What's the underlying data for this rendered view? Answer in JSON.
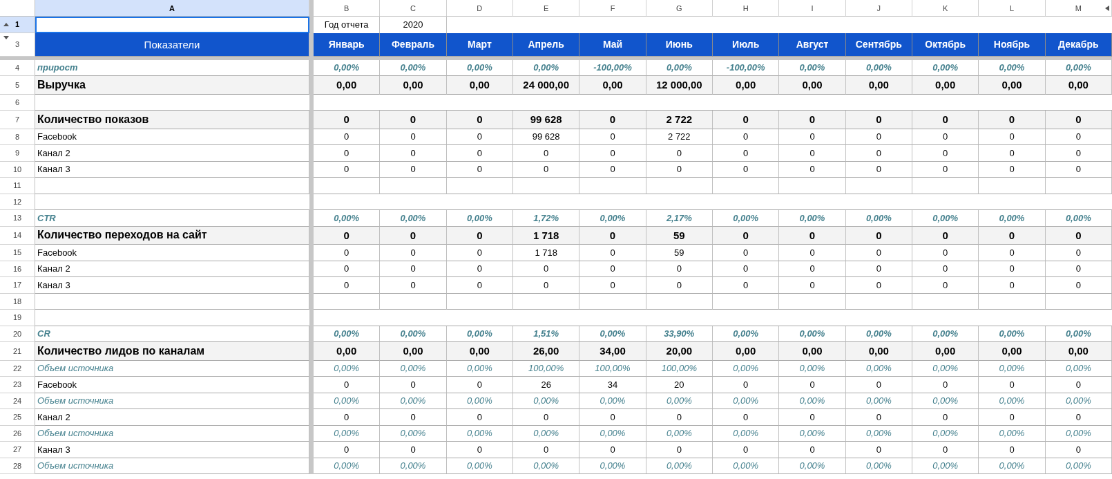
{
  "columns": [
    {
      "letter": "A",
      "selected": true
    },
    {
      "letter": "B",
      "selected": false
    },
    {
      "letter": "C",
      "selected": false
    },
    {
      "letter": "D",
      "selected": false
    },
    {
      "letter": "E",
      "selected": false
    },
    {
      "letter": "F",
      "selected": false
    },
    {
      "letter": "G",
      "selected": false
    },
    {
      "letter": "H",
      "selected": false
    },
    {
      "letter": "I",
      "selected": false
    },
    {
      "letter": "J",
      "selected": false
    },
    {
      "letter": "K",
      "selected": false
    },
    {
      "letter": "L",
      "selected": false
    },
    {
      "letter": "M",
      "selected": false
    }
  ],
  "top_row": {
    "number": "1",
    "selected": true,
    "label_cell_selected": true,
    "year_label": "Год отчета",
    "year": "2020"
  },
  "header_row": {
    "number": "3",
    "title": "Показатели",
    "months": [
      "Январь",
      "Февраль",
      "Март",
      "Апрель",
      "Май",
      "Июнь",
      "Июль",
      "Август",
      "Сентябрь",
      "Октябрь",
      "Ноябрь",
      "Декабрь"
    ]
  },
  "rows": [
    {
      "number": "4",
      "kind": "pct",
      "label": "прирост",
      "values": [
        "0,00%",
        "0,00%",
        "0,00%",
        "0,00%",
        "-100,00%",
        "0,00%",
        "-100,00%",
        "0,00%",
        "0,00%",
        "0,00%",
        "0,00%",
        "0,00%"
      ]
    },
    {
      "number": "5",
      "kind": "total",
      "label": "Выручка",
      "values": [
        "0,00",
        "0,00",
        "0,00",
        "24 000,00",
        "0,00",
        "12 000,00",
        "0,00",
        "0,00",
        "0,00",
        "0,00",
        "0,00",
        "0,00"
      ]
    },
    {
      "number": "6",
      "kind": "gap"
    },
    {
      "number": "7",
      "kind": "total",
      "label": "Количество показов",
      "values": [
        "0",
        "0",
        "0",
        "99 628",
        "0",
        "2 722",
        "0",
        "0",
        "0",
        "0",
        "0",
        "0"
      ]
    },
    {
      "number": "8",
      "kind": "plain",
      "label": "Facebook",
      "values": [
        "0",
        "0",
        "0",
        "99 628",
        "0",
        "2 722",
        "0",
        "0",
        "0",
        "0",
        "0",
        "0"
      ]
    },
    {
      "number": "9",
      "kind": "plain",
      "label": "Канал 2",
      "values": [
        "0",
        "0",
        "0",
        "0",
        "0",
        "0",
        "0",
        "0",
        "0",
        "0",
        "0",
        "0"
      ]
    },
    {
      "number": "10",
      "kind": "plain",
      "label": "Канал 3",
      "values": [
        "0",
        "0",
        "0",
        "0",
        "0",
        "0",
        "0",
        "0",
        "0",
        "0",
        "0",
        "0"
      ]
    },
    {
      "number": "11",
      "kind": "blank"
    },
    {
      "number": "12",
      "kind": "gap"
    },
    {
      "number": "13",
      "kind": "pct",
      "label": "CTR",
      "values": [
        "0,00%",
        "0,00%",
        "0,00%",
        "1,72%",
        "0,00%",
        "2,17%",
        "0,00%",
        "0,00%",
        "0,00%",
        "0,00%",
        "0,00%",
        "0,00%"
      ]
    },
    {
      "number": "14",
      "kind": "total",
      "label": "Количество переходов на сайт",
      "values": [
        "0",
        "0",
        "0",
        "1 718",
        "0",
        "59",
        "0",
        "0",
        "0",
        "0",
        "0",
        "0"
      ]
    },
    {
      "number": "15",
      "kind": "plain",
      "label": "Facebook",
      "values": [
        "0",
        "0",
        "0",
        "1 718",
        "0",
        "59",
        "0",
        "0",
        "0",
        "0",
        "0",
        "0"
      ]
    },
    {
      "number": "16",
      "kind": "plain",
      "label": "Канал 2",
      "values": [
        "0",
        "0",
        "0",
        "0",
        "0",
        "0",
        "0",
        "0",
        "0",
        "0",
        "0",
        "0"
      ]
    },
    {
      "number": "17",
      "kind": "plain",
      "label": "Канал 3",
      "values": [
        "0",
        "0",
        "0",
        "0",
        "0",
        "0",
        "0",
        "0",
        "0",
        "0",
        "0",
        "0"
      ]
    },
    {
      "number": "18",
      "kind": "blank"
    },
    {
      "number": "19",
      "kind": "gap"
    },
    {
      "number": "20",
      "kind": "pct",
      "label": "CR",
      "values": [
        "0,00%",
        "0,00%",
        "0,00%",
        "1,51%",
        "0,00%",
        "33,90%",
        "0,00%",
        "0,00%",
        "0,00%",
        "0,00%",
        "0,00%",
        "0,00%"
      ]
    },
    {
      "number": "21",
      "kind": "total",
      "label": "Количество лидов по каналам",
      "values": [
        "0,00",
        "0,00",
        "0,00",
        "26,00",
        "34,00",
        "20,00",
        "0,00",
        "0,00",
        "0,00",
        "0,00",
        "0,00",
        "0,00"
      ]
    },
    {
      "number": "22",
      "kind": "share",
      "label": "Объем источника",
      "values": [
        "0,00%",
        "0,00%",
        "0,00%",
        "100,00%",
        "100,00%",
        "100,00%",
        "0,00%",
        "0,00%",
        "0,00%",
        "0,00%",
        "0,00%",
        "0,00%"
      ]
    },
    {
      "number": "23",
      "kind": "plain",
      "label": "Facebook",
      "values": [
        "0",
        "0",
        "0",
        "26",
        "34",
        "20",
        "0",
        "0",
        "0",
        "0",
        "0",
        "0"
      ]
    },
    {
      "number": "24",
      "kind": "share",
      "label": "Объем источника",
      "values": [
        "0,00%",
        "0,00%",
        "0,00%",
        "0,00%",
        "0,00%",
        "0,00%",
        "0,00%",
        "0,00%",
        "0,00%",
        "0,00%",
        "0,00%",
        "0,00%"
      ]
    },
    {
      "number": "25",
      "kind": "plain",
      "label": "Канал 2",
      "values": [
        "0",
        "0",
        "0",
        "0",
        "0",
        "0",
        "0",
        "0",
        "0",
        "0",
        "0",
        "0"
      ]
    },
    {
      "number": "26",
      "kind": "share",
      "label": "Объем источника",
      "values": [
        "0,00%",
        "0,00%",
        "0,00%",
        "0,00%",
        "0,00%",
        "0,00%",
        "0,00%",
        "0,00%",
        "0,00%",
        "0,00%",
        "0,00%",
        "0,00%"
      ]
    },
    {
      "number": "27",
      "kind": "plain",
      "label": "Канал 3",
      "values": [
        "0",
        "0",
        "0",
        "0",
        "0",
        "0",
        "0",
        "0",
        "0",
        "0",
        "0",
        "0"
      ]
    },
    {
      "number": "28",
      "kind": "share",
      "label": "Объем источника",
      "values": [
        "0,00%",
        "0,00%",
        "0,00%",
        "0,00%",
        "0,00%",
        "0,00%",
        "0,00%",
        "0,00%",
        "0,00%",
        "0,00%",
        "0,00%",
        "0,00%"
      ]
    }
  ]
}
